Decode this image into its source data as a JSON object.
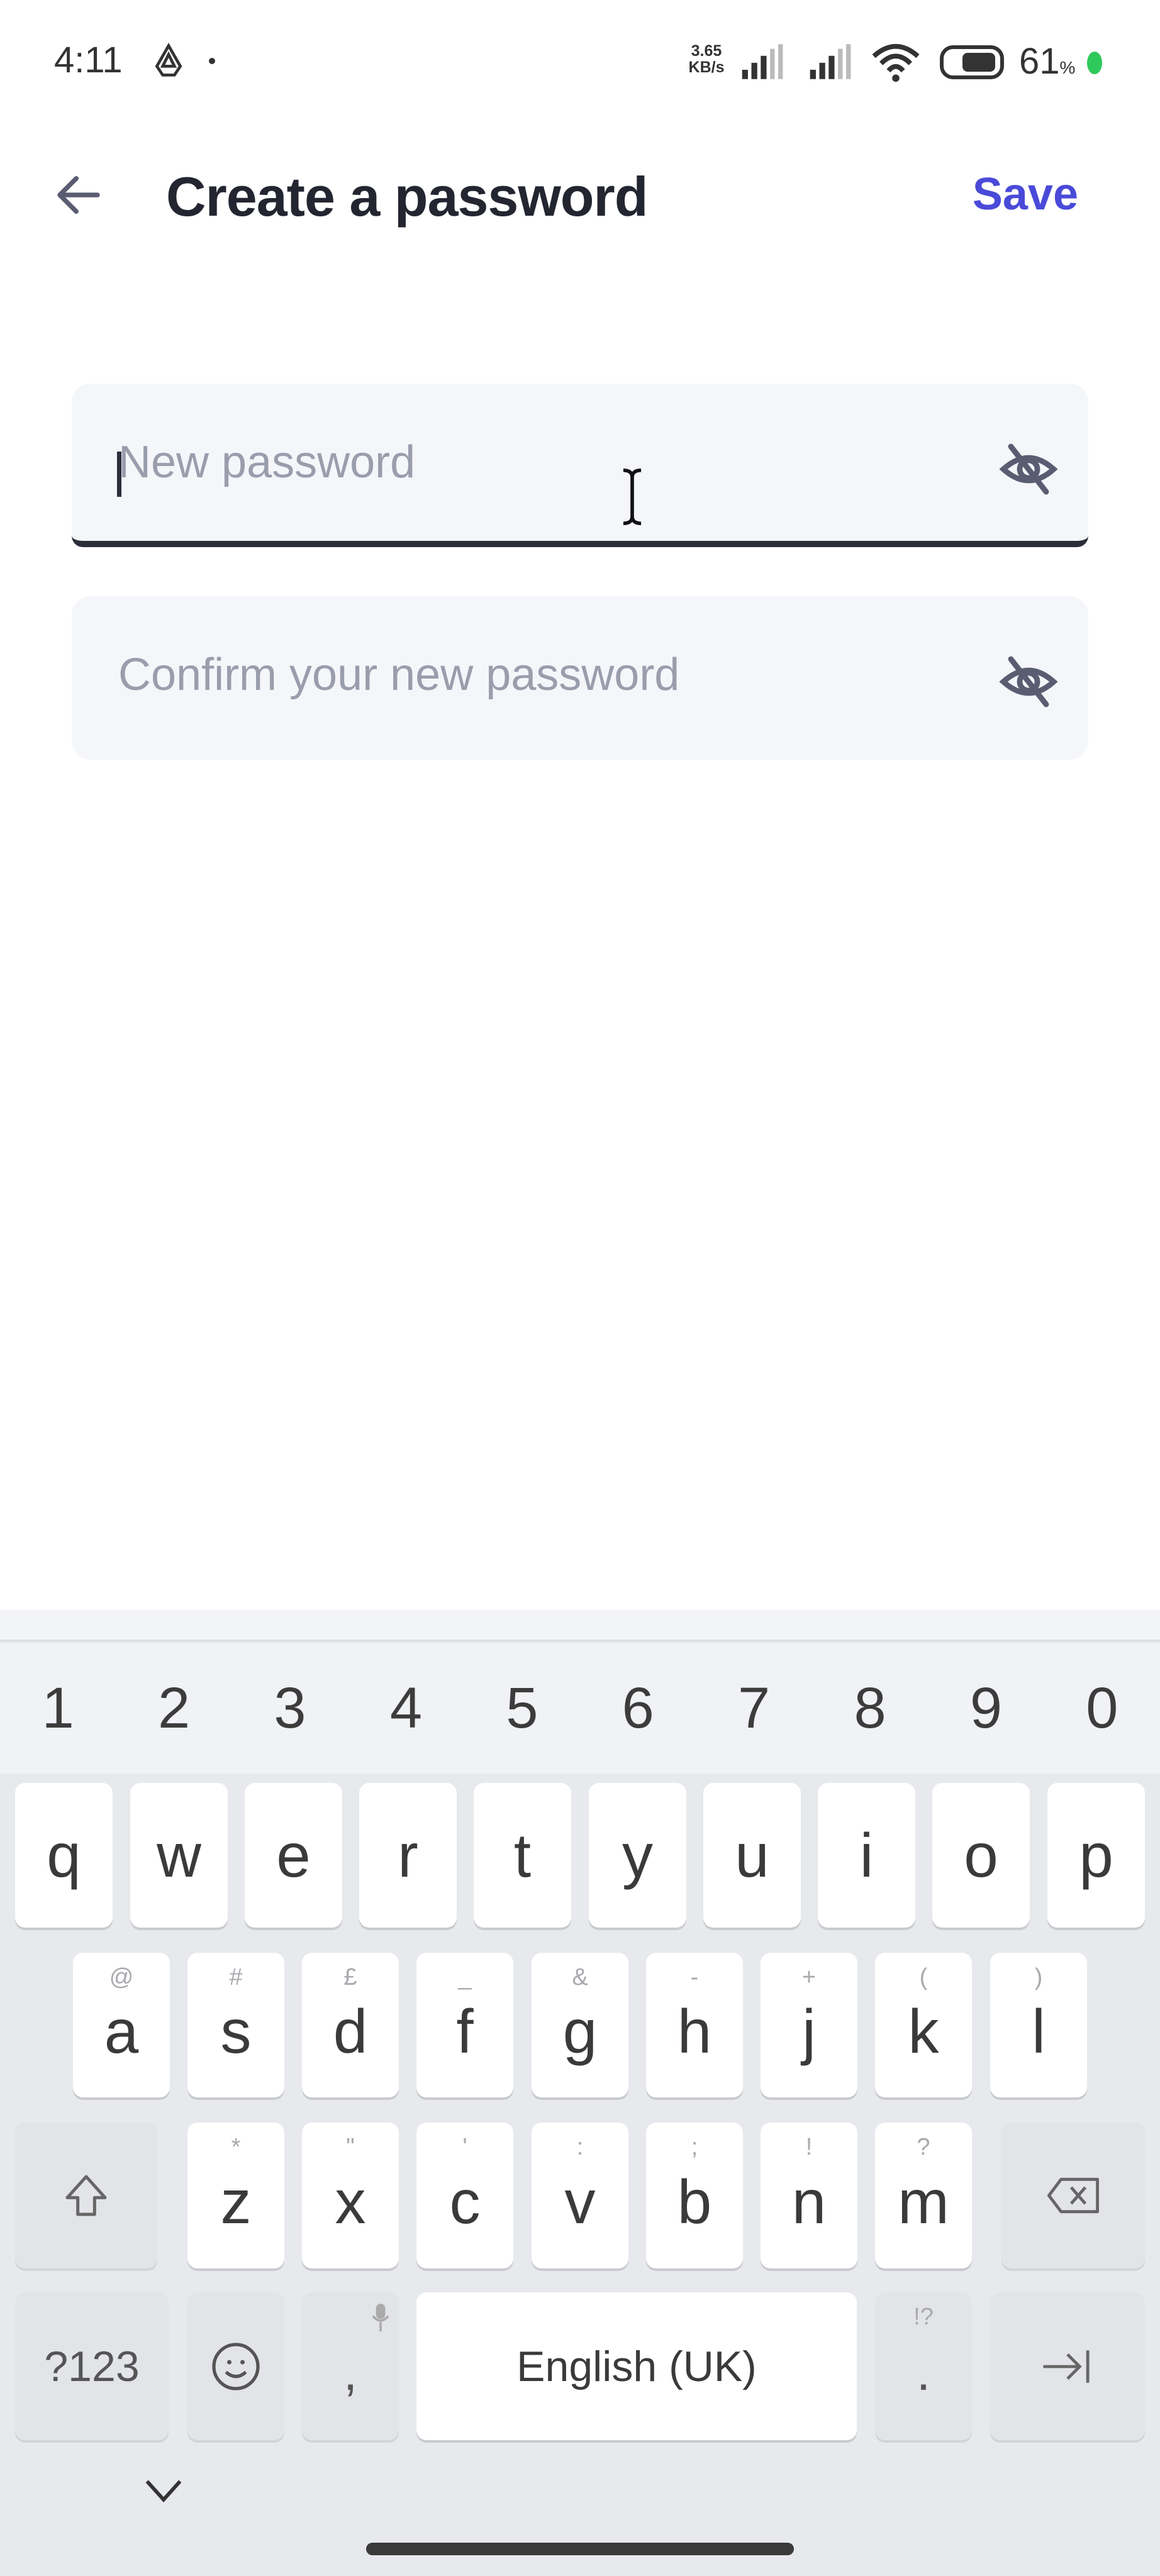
{
  "status_bar": {
    "time": "4:11",
    "net_speed_value": "3.65",
    "net_speed_unit": "KB/s",
    "battery_percent": "61",
    "battery_unit": "%",
    "icons": [
      "drive-icon",
      "notification-dot",
      "signal-icon",
      "signal-icon",
      "wifi-icon",
      "battery-icon",
      "privacy-indicator"
    ],
    "indicator_color": "#2ec95a"
  },
  "header": {
    "back_icon": "arrow-left-icon",
    "title": "Create a password",
    "save_label": "Save",
    "accent_color": "#4a4ad9"
  },
  "form": {
    "new_password": {
      "value": "",
      "placeholder": "New password",
      "focused": true,
      "visibility_icon": "eye-off-icon"
    },
    "confirm_password": {
      "value": "",
      "placeholder": "Confirm your new password",
      "focused": false,
      "visibility_icon": "eye-off-icon"
    }
  },
  "keyboard": {
    "number_row": [
      "1",
      "2",
      "3",
      "4",
      "5",
      "6",
      "7",
      "8",
      "9",
      "0"
    ],
    "row1": [
      {
        "key": "q"
      },
      {
        "key": "w"
      },
      {
        "key": "e"
      },
      {
        "key": "r"
      },
      {
        "key": "t"
      },
      {
        "key": "y"
      },
      {
        "key": "u"
      },
      {
        "key": "i"
      },
      {
        "key": "o"
      },
      {
        "key": "p"
      }
    ],
    "row2": [
      {
        "key": "a",
        "hint": "@"
      },
      {
        "key": "s",
        "hint": "#"
      },
      {
        "key": "d",
        "hint": "£"
      },
      {
        "key": "f",
        "hint": "_"
      },
      {
        "key": "g",
        "hint": "&"
      },
      {
        "key": "h",
        "hint": "-"
      },
      {
        "key": "j",
        "hint": "+"
      },
      {
        "key": "k",
        "hint": "("
      },
      {
        "key": "l",
        "hint": ")"
      }
    ],
    "row3": [
      {
        "key": "z",
        "hint": "*"
      },
      {
        "key": "x",
        "hint": "\""
      },
      {
        "key": "c",
        "hint": "'"
      },
      {
        "key": "v",
        "hint": ":"
      },
      {
        "key": "b",
        "hint": ";"
      },
      {
        "key": "n",
        "hint": "!"
      },
      {
        "key": "m",
        "hint": "?"
      }
    ],
    "shift_icon": "shift-icon",
    "backspace_icon": "backspace-icon",
    "symbols_label": "?123",
    "emoji_icon": "emoji-icon",
    "comma_label": ",",
    "comma_hint_icon": "microphone-icon",
    "space_label": "English (UK)",
    "period_label": ".",
    "period_hint": "!?",
    "next_icon": "tab-next-icon",
    "hide_keyboard_icon": "chevron-down-icon"
  }
}
